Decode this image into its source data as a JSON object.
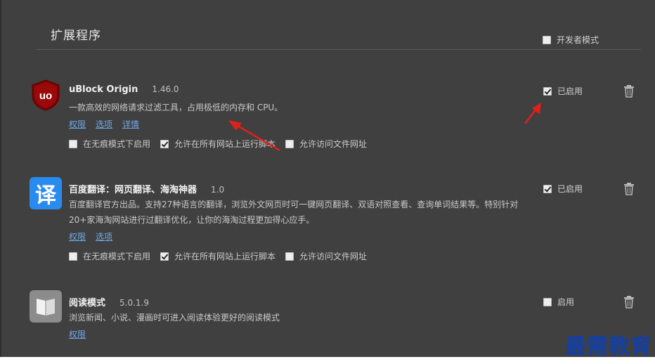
{
  "header": {
    "title": "扩展程序",
    "dev_mode_label": "开发者模式",
    "dev_mode_checked": false
  },
  "extensions": [
    {
      "name": "uBlock Origin",
      "version": "1.46.0",
      "description": "一款高效的网络请求过滤工具，占用极低的内存和 CPU。",
      "links": [
        "权限",
        "选项",
        "详情"
      ],
      "options": [
        {
          "label": "在无痕模式下启用",
          "checked": false
        },
        {
          "label": "允许在所有网站上运行脚本",
          "checked": true
        },
        {
          "label": "允许访问文件网址",
          "checked": false
        }
      ],
      "enable_label": "已启用",
      "enabled": true,
      "icon": "ublock-origin-icon"
    },
    {
      "name": "百度翻译：网页翻译、海淘神器",
      "version": "1.0",
      "description": "百度翻译官方出品。支持27种语言的翻译，浏览外文网页时可一键网页翻译、双语对照查看、查询单词结果等。特别针对20+家海淘网站进行过翻译优化，让你的海淘过程更加得心应手。",
      "links": [
        "权限",
        "选项"
      ],
      "options": [
        {
          "label": "在无痕模式下启用",
          "checked": false
        },
        {
          "label": "允许在所有网站上运行脚本",
          "checked": true
        },
        {
          "label": "允许访问文件网址",
          "checked": false
        }
      ],
      "enable_label": "已启用",
      "enabled": true,
      "icon": "baidu-translate-icon",
      "icon_glyph": "译"
    },
    {
      "name": "阅读模式",
      "version": "5.0.1.9",
      "description": "浏览新闻、小说、漫画时可进入阅读体验更好的阅读模式",
      "links": [
        "权限"
      ],
      "options": [],
      "enable_label": "启用",
      "enabled": false,
      "icon": "reader-mode-icon"
    }
  ],
  "watermark": "最需教育",
  "colors": {
    "panel_bg": "#404040",
    "link": "#6fa8e6",
    "arrow": "#e0201a",
    "watermark": "#123fa8",
    "ublock_red": "#800000",
    "baidu_blue": "#2a8bef"
  }
}
